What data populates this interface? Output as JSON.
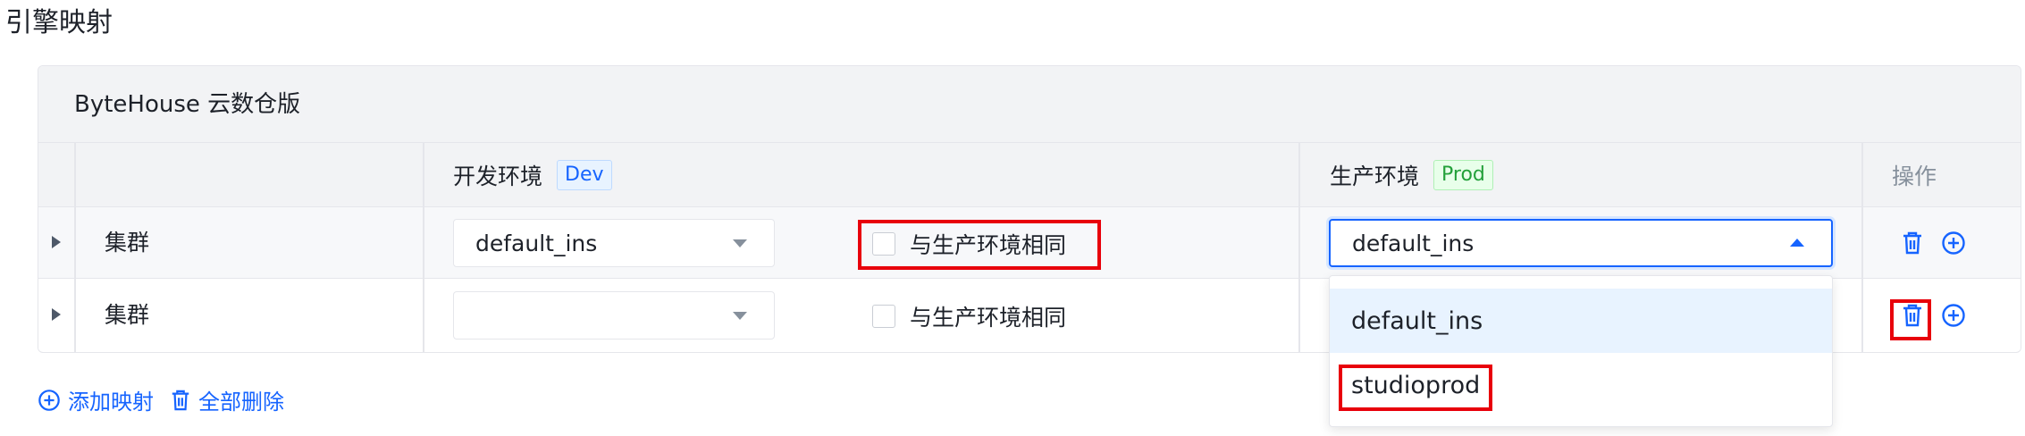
{
  "page": {
    "title": "引擎映射"
  },
  "card": {
    "title": "ByteHouse 云数仓版"
  },
  "table": {
    "headers": {
      "dev_label": "开发环境",
      "dev_tag": "Dev",
      "prod_label": "生产环境",
      "prod_tag": "Prod",
      "actions": "操作"
    },
    "rows": [
      {
        "name": "集群",
        "dev_value": "default_ins",
        "same_as_prod_label": "与生产环境相同",
        "prod_value": "default_ins"
      },
      {
        "name": "集群",
        "dev_value": "",
        "same_as_prod_label": "与生产环境相同",
        "prod_value": ""
      }
    ]
  },
  "dropdown": {
    "options": [
      "default_ins",
      "studioprod"
    ],
    "highlighted": "default_ins"
  },
  "footer": {
    "add_label": "添加映射",
    "delete_all_label": "全部删除"
  },
  "colors": {
    "accent": "#1664ff",
    "highlight": "#e8000b",
    "dev_tag": "#1664ff",
    "prod_tag": "#23a03a"
  },
  "icons": [
    "expand-icon",
    "trash-icon",
    "plus-circle-icon",
    "chevron-down-icon",
    "chevron-up-icon"
  ]
}
